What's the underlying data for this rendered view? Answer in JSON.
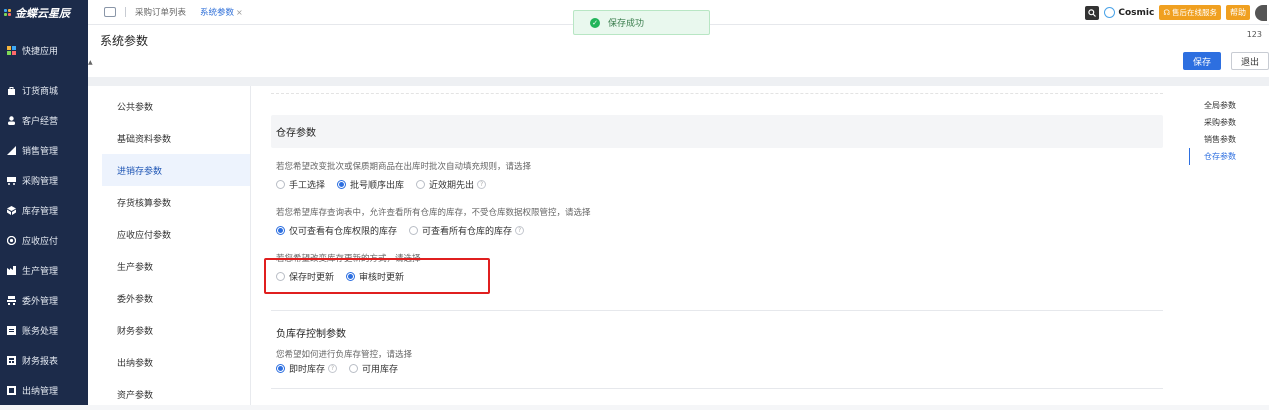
{
  "app": {
    "logo": "金蝶云星辰"
  },
  "sidebar": {
    "items": [
      {
        "label": "快捷应用",
        "icon": "grid-icon"
      },
      {
        "label": "订货商城",
        "icon": "bag-icon"
      },
      {
        "label": "客户经营",
        "icon": "user-icon"
      },
      {
        "label": "销售管理",
        "icon": "chart-icon"
      },
      {
        "label": "采购管理",
        "icon": "cart-icon"
      },
      {
        "label": "库存管理",
        "icon": "cube-icon"
      },
      {
        "label": "应收应付",
        "icon": "coin-icon"
      },
      {
        "label": "生产管理",
        "icon": "factory-icon"
      },
      {
        "label": "委外管理",
        "icon": "outsource-icon"
      },
      {
        "label": "账务处理",
        "icon": "ledger-icon"
      },
      {
        "label": "财务报表",
        "icon": "report-icon"
      },
      {
        "label": "出纳管理",
        "icon": "cashier-icon"
      }
    ]
  },
  "tabs": [
    {
      "label": "采购订单列表",
      "active": false
    },
    {
      "label": "系统参数",
      "active": true,
      "close": "×"
    }
  ],
  "topbar": {
    "cosmic": "Cosmic",
    "service": "售后在线服务",
    "help": "帮助"
  },
  "toast": {
    "message": "保存成功"
  },
  "header": {
    "title": "系统参数",
    "counter": "123",
    "save": "保存",
    "exit": "退出"
  },
  "categories": [
    {
      "label": "公共参数",
      "active": false
    },
    {
      "label": "基础资料参数",
      "active": false
    },
    {
      "label": "进销存参数",
      "active": true
    },
    {
      "label": "存货核算参数",
      "active": false
    },
    {
      "label": "应收应付参数",
      "active": false
    },
    {
      "label": "生产参数",
      "active": false
    },
    {
      "label": "委外参数",
      "active": false
    },
    {
      "label": "财务参数",
      "active": false
    },
    {
      "label": "出纳参数",
      "active": false
    },
    {
      "label": "资产参数",
      "active": false
    }
  ],
  "inventory": {
    "title": "仓存参数",
    "q1": {
      "label": "若您希望改变批次或保质期商品在出库时批次自动填充规则，请选择",
      "options": [
        "手工选择",
        "批号顺序出库",
        "近效期先出"
      ],
      "selected": 1
    },
    "q2": {
      "label": "若您希望库存查询表中，允许查看所有仓库的库存，不受仓库数据权限管控，请选择",
      "options": [
        "仅可查看有仓库权限的库存",
        "可查看所有仓库的库存"
      ],
      "selected": 0
    },
    "q3": {
      "label": "若您希望改变库存更新的方式，请选择",
      "options": [
        "保存时更新",
        "审核时更新"
      ],
      "selected": 1
    }
  },
  "negative": {
    "title": "负库存控制参数",
    "q1": {
      "label": "您希望如何进行负库存管控，请选择",
      "options": [
        "即时库存",
        "可用库存"
      ],
      "selected": 0
    }
  },
  "anchors": [
    {
      "label": "全局参数",
      "active": false
    },
    {
      "label": "采购参数",
      "active": false
    },
    {
      "label": "销售参数",
      "active": false
    },
    {
      "label": "仓存参数",
      "active": true
    }
  ],
  "colors": {
    "primary": "#2d6fe0",
    "sidebar": "#1c2b4a",
    "highlight": "#e01f1f",
    "success": "#22b45a"
  }
}
